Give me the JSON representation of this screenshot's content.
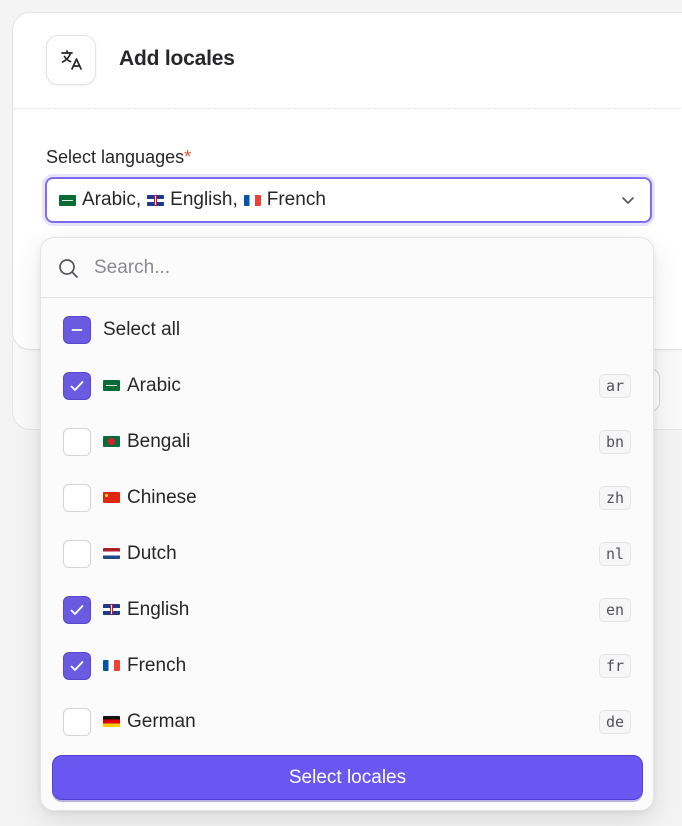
{
  "dialog": {
    "title": "Add locales",
    "icon": "translate-icon",
    "field_label": "Select languages",
    "required_mark": "*",
    "selected_values": [
      {
        "flag": "ar",
        "label": "Arabic",
        "suffix": ","
      },
      {
        "flag": "en",
        "label": "English",
        "suffix": ","
      },
      {
        "flag": "fr",
        "label": "French",
        "suffix": ""
      }
    ]
  },
  "dropdown": {
    "search_placeholder": "Search...",
    "select_all_label": "Select all",
    "select_all_state": "partial",
    "options": [
      {
        "label": "Arabic",
        "code": "ar",
        "flag": "ar",
        "checked": true
      },
      {
        "label": "Bengali",
        "code": "bn",
        "flag": "bn",
        "checked": false
      },
      {
        "label": "Chinese",
        "code": "zh",
        "flag": "zh",
        "checked": false
      },
      {
        "label": "Dutch",
        "code": "nl",
        "flag": "nl",
        "checked": false
      },
      {
        "label": "English",
        "code": "en",
        "flag": "en",
        "checked": true
      },
      {
        "label": "French",
        "code": "fr",
        "flag": "fr",
        "checked": true
      },
      {
        "label": "German",
        "code": "de",
        "flag": "de",
        "checked": false
      }
    ],
    "submit_label": "Select locales"
  },
  "colors": {
    "accent": "#6a56f0",
    "focus_ring": "#7c6cf0",
    "required": "#e4572e"
  }
}
